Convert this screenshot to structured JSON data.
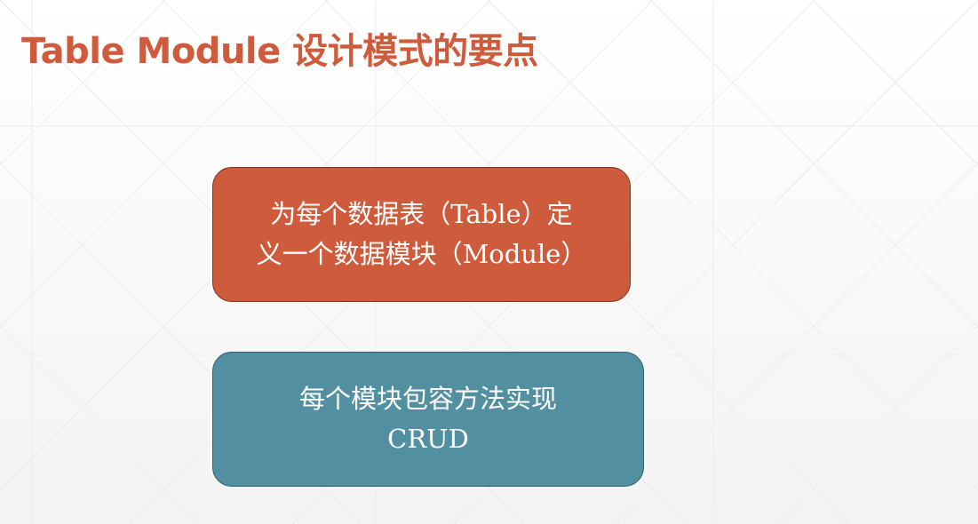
{
  "slide": {
    "title": "Table Module 设计模式的要点",
    "title_color": "#CF5B3D"
  },
  "boxes": [
    {
      "lines": [
        "为每个数据表（Table）定",
        "义一个数据模块（Module）"
      ],
      "fill": "#CF5B3D"
    },
    {
      "lines": [
        "每个模块包容方法实现",
        "CRUD"
      ],
      "fill": "#528FA1"
    }
  ]
}
